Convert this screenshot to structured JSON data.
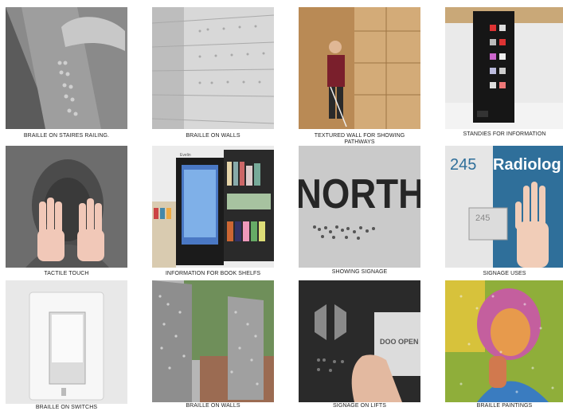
{
  "tiles": [
    {
      "caption": "BRAILLE ON STAIRES RAILING."
    },
    {
      "caption": "BRAILLE ON WALLS"
    },
    {
      "caption": "TEXTURED WALL FOR SHOWING PATHWAYS"
    },
    {
      "caption": "STANDIES FOR  INFORMATION"
    },
    {
      "caption": "TACTILE TOUCH"
    },
    {
      "caption": "INFORMATION FOR BOOK SHELFS"
    },
    {
      "caption": "SHOWING SIGNAGE"
    },
    {
      "caption": "SIGNAGE USES"
    },
    {
      "caption": "BRAILLE ON SWITCHS"
    },
    {
      "caption": "BRAILLE ON WALLS"
    },
    {
      "caption": "SIGNAGE ON LIFTS"
    },
    {
      "caption": "BRAILLE PAINTINGS"
    }
  ],
  "image_text": {
    "north_sign": "NORTH",
    "room_number": "245",
    "room_number_small": "245",
    "radiology": "Radiolog",
    "kiosk_brand": "Evelin",
    "lift_text": "DOO OPEN"
  }
}
